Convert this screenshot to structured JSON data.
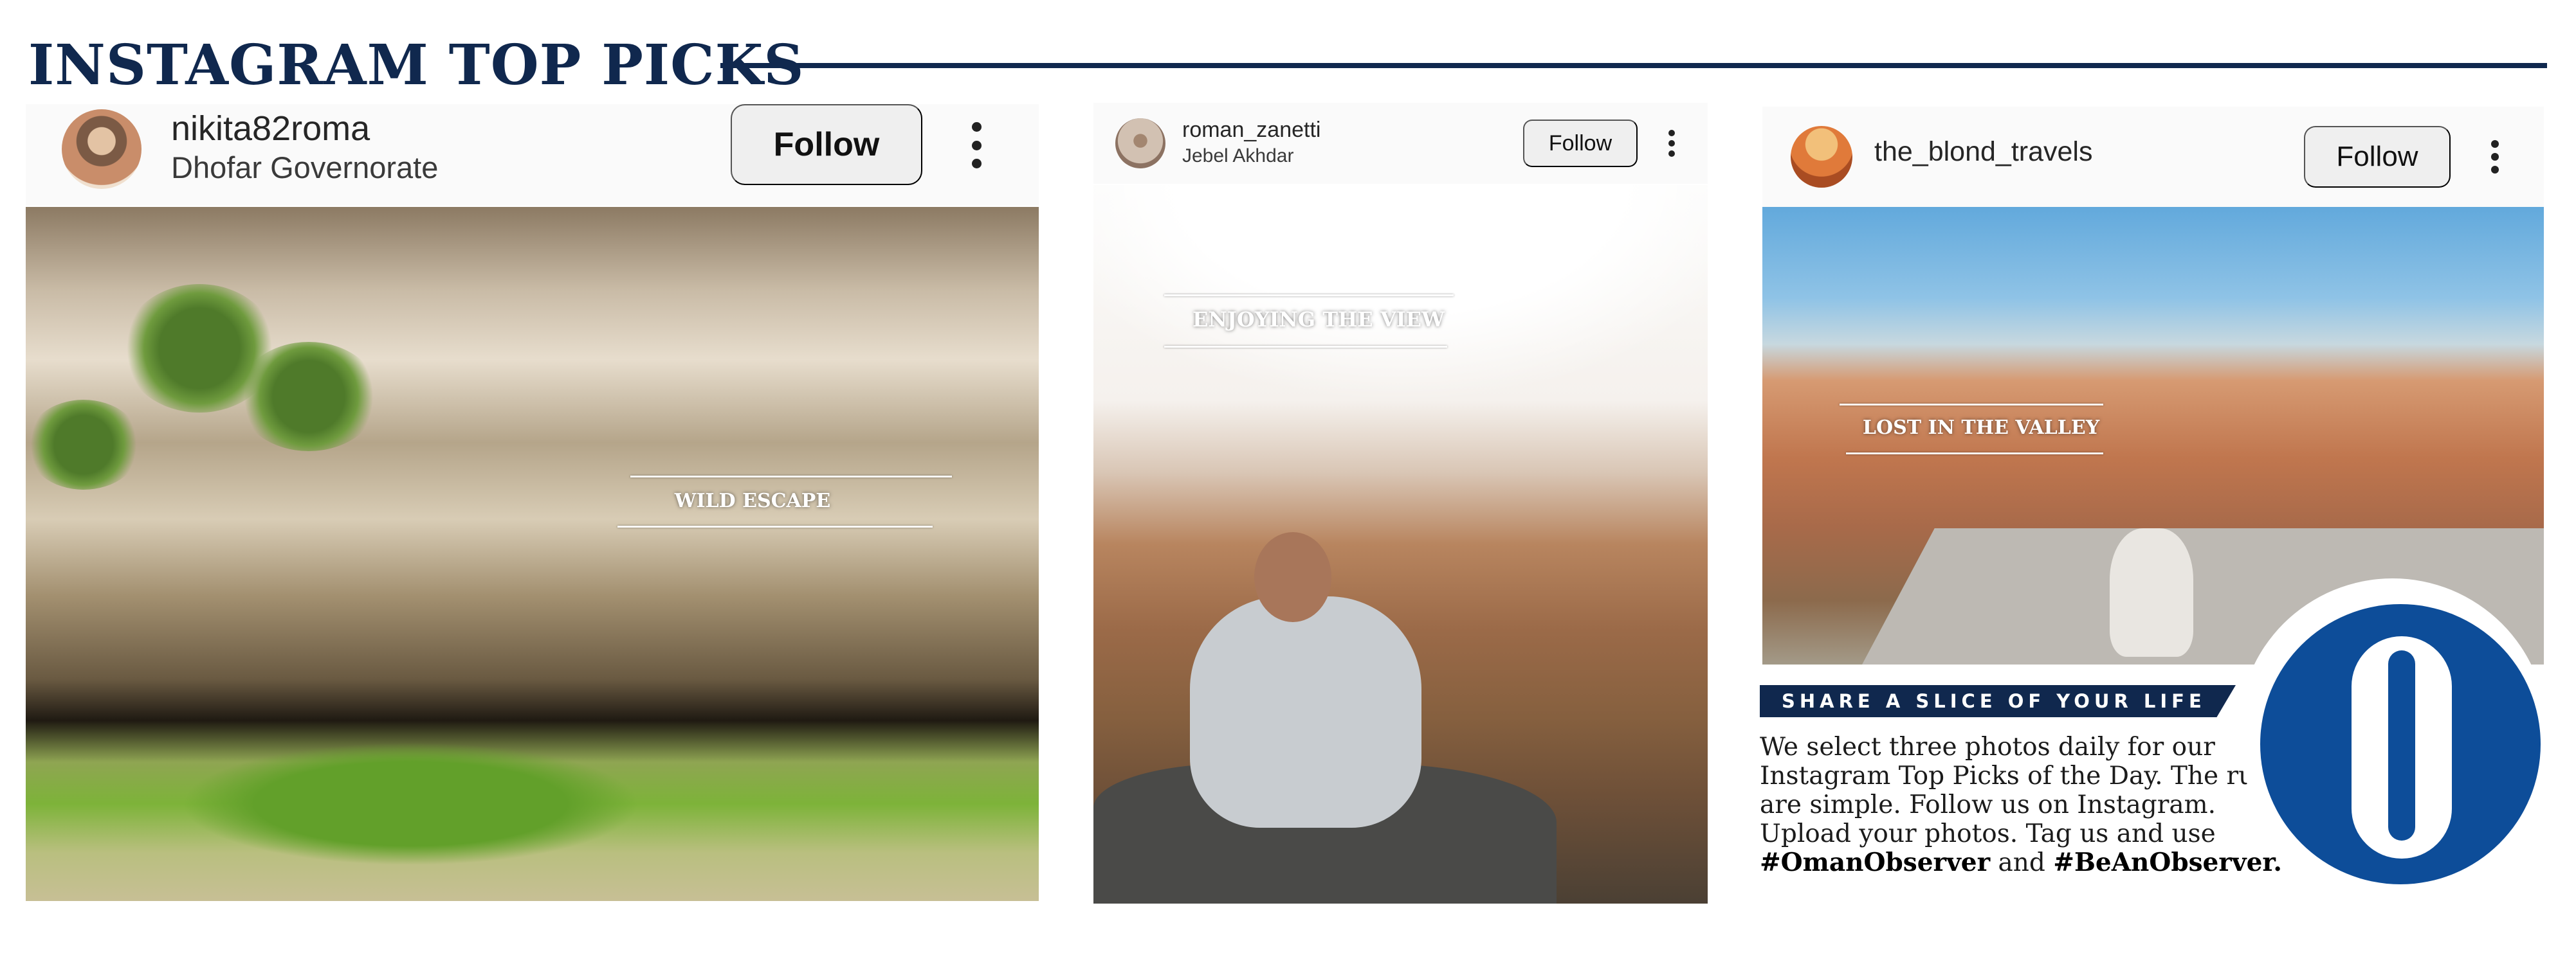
{
  "header": {
    "title": "INSTAGRAM TOP PICKS"
  },
  "posts": [
    {
      "username": "nikita82roma",
      "location": "Dhofar Governorate",
      "follow_label": "Follow",
      "caption": "WILD ESCAPE"
    },
    {
      "username": "roman_zanetti",
      "location": "Jebel Akhdar",
      "follow_label": "Follow",
      "caption": "ENJOYING THE VIEW"
    },
    {
      "username": "the_blond_travels",
      "location": "",
      "follow_label": "Follow",
      "caption": "LOST IN THE VALLEY"
    }
  ],
  "share": {
    "heading": "SHARE A SLICE OF YOUR LIFE",
    "body": "We select three photos daily for our Instagram Top Picks of the Day. The rules are simple. Follow us on Instagram. Upload your photos. Tag us and use",
    "hashtag1": "#OmanObserver",
    "connector": "and",
    "hashtag2": "#BeAnObserver."
  },
  "colors": {
    "navy": "#10284e",
    "logo_blue": "#0d4d99"
  },
  "icons": [
    "more-options-icon",
    "avatar"
  ]
}
